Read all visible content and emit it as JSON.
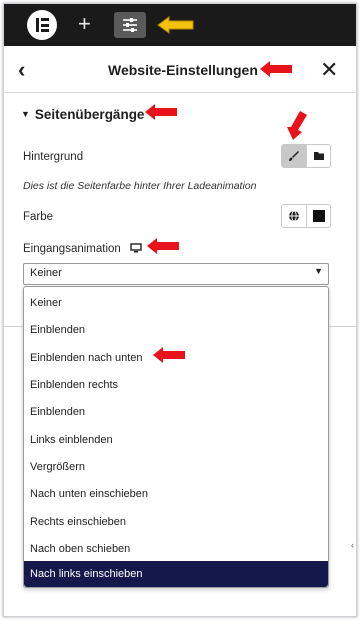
{
  "topbar": {
    "logo_icon": "elementor-logo-icon",
    "add_icon": "plus-icon",
    "add_glyph": "+",
    "settings_icon": "sliders-icon"
  },
  "header": {
    "back_glyph": "‹",
    "title": "Website-Einstellungen",
    "close_glyph": "✕"
  },
  "section": {
    "title": "Seitenübergänge",
    "caret": "▼"
  },
  "fields": {
    "background_label": "Hintergrund",
    "background_note": "Dies ist die Seitenfarbe hinter Ihrer Ladeanimation",
    "color_label": "Farbe",
    "entrance_label": "Eingangsanimation",
    "entrance_value": "Keiner"
  },
  "dropdown": {
    "options": [
      "Keiner",
      "Einblenden",
      "Einblenden nach unten",
      "Einblenden rechts",
      "Einblenden",
      "Links einblenden",
      "Vergrößern",
      "Nach unten einschieben",
      "Rechts einschieben",
      "Nach oben schieben",
      "Nach links einschieben"
    ],
    "highlighted_index": 10
  },
  "colors": {
    "topbar": "#1a1a1a",
    "highlight": "#15184a",
    "annotation_red": "#e8121a",
    "annotation_yellow": "#f4c20d"
  }
}
